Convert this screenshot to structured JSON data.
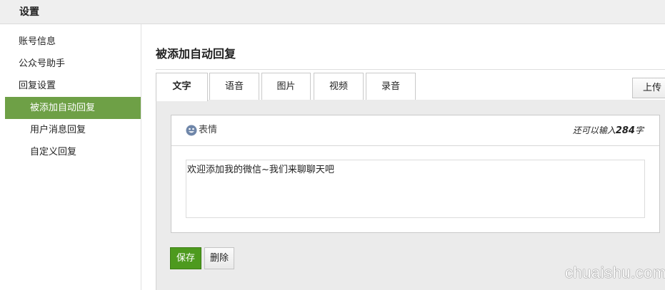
{
  "topbar": {
    "title": "设置"
  },
  "sidebar": {
    "items": [
      {
        "label": "账号信息"
      },
      {
        "label": "公众号助手"
      },
      {
        "label": "回复设置"
      },
      {
        "label": "被添加自动回复"
      },
      {
        "label": "用户消息回复"
      },
      {
        "label": "自定义回复"
      }
    ],
    "active_color": "#6ea046"
  },
  "main": {
    "title": "被添加自动回复",
    "tabs": [
      {
        "label": "文字"
      },
      {
        "label": "语音"
      },
      {
        "label": "图片"
      },
      {
        "label": "视频"
      },
      {
        "label": "录音"
      }
    ],
    "upload_label": "上传"
  },
  "editor": {
    "emoji_label": "表情",
    "counter_prefix": "还可以输入",
    "counter_value": "284",
    "counter_suffix": "字",
    "content": "欢迎添加我的微信~我们来聊聊天吧"
  },
  "actions": {
    "save_label": "保存",
    "delete_label": "删除",
    "save_color": "#4d9a1e"
  },
  "watermark": "chuaishu.com"
}
